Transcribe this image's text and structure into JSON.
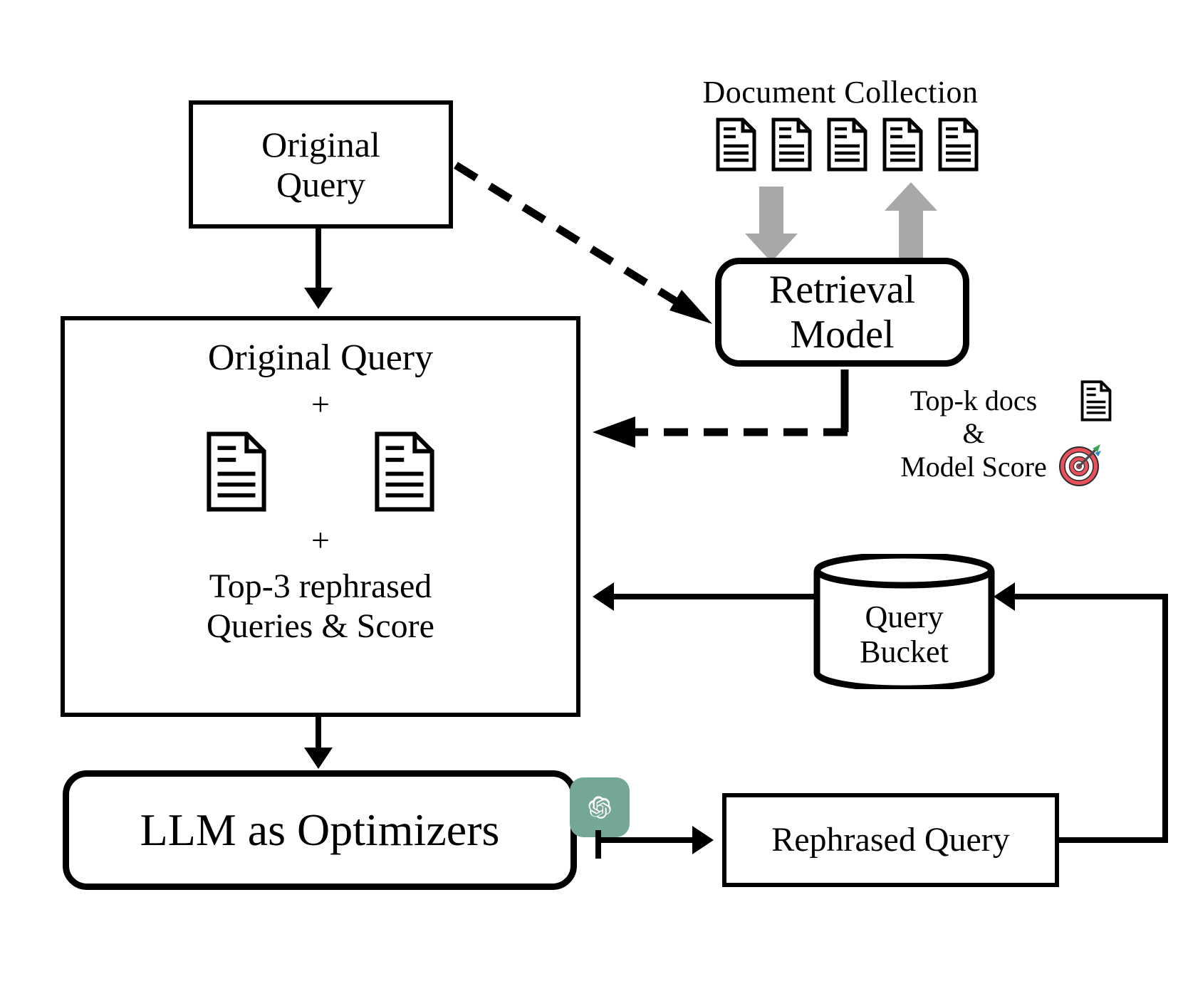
{
  "diagram": {
    "title": "LLM as Optimizers query rewriting pipeline",
    "colors": {
      "stroke": "#000000",
      "gray_arrow": "#a8a8a8",
      "openai_badge": "#74a894",
      "target_red": "#e8505b",
      "target_white": "#ffffff",
      "dart_green": "#3aa655"
    }
  },
  "nodes": {
    "original_query": {
      "label": "Original\nQuery",
      "line1": "Original",
      "line2": "Query"
    },
    "combined_input": {
      "title": "Original Query",
      "plus_1": "+",
      "plus_2": "+",
      "tail_line1": "Top-3 rephrased",
      "tail_line2": "Queries & Score"
    },
    "retrieval_model": {
      "line1": "Retrieval",
      "line2": "Model"
    },
    "query_bucket": {
      "line1": "Query",
      "line2": "Bucket"
    },
    "llm_optimizers": {
      "label": "LLM as Optimizers"
    },
    "rephrased_query": {
      "label": "Rephrased Query"
    }
  },
  "labels": {
    "document_collection": "Document  Collection",
    "topk_line1": "Top-k docs",
    "topk_line2": "&",
    "topk_line3": "Model Score"
  },
  "icons": {
    "document": "document-icon",
    "openai": "openai-logo-icon",
    "target": "target-emoji-icon",
    "document_collection_count": 5,
    "combined_doc_count": 2
  },
  "edges": [
    {
      "from": "original_query",
      "to": "combined_input",
      "style": "solid",
      "direction": "down"
    },
    {
      "from": "original_query",
      "to": "retrieval_model",
      "style": "dashed",
      "direction": "down-right"
    },
    {
      "from": "document_collection",
      "to": "retrieval_model",
      "style": "gray-block",
      "direction": "down"
    },
    {
      "from": "retrieval_model",
      "to": "document_collection",
      "style": "gray-block",
      "direction": "up"
    },
    {
      "from": "retrieval_model",
      "to": "combined_input",
      "style": "dashed",
      "direction": "left"
    },
    {
      "from": "query_bucket",
      "to": "combined_input",
      "style": "solid",
      "direction": "left"
    },
    {
      "from": "combined_input",
      "to": "llm_optimizers",
      "style": "solid",
      "direction": "down"
    },
    {
      "from": "llm_optimizers",
      "to": "rephrased_query",
      "style": "solid",
      "direction": "right"
    },
    {
      "from": "rephrased_query",
      "to": "query_bucket",
      "style": "solid",
      "direction": "up-left"
    }
  ]
}
